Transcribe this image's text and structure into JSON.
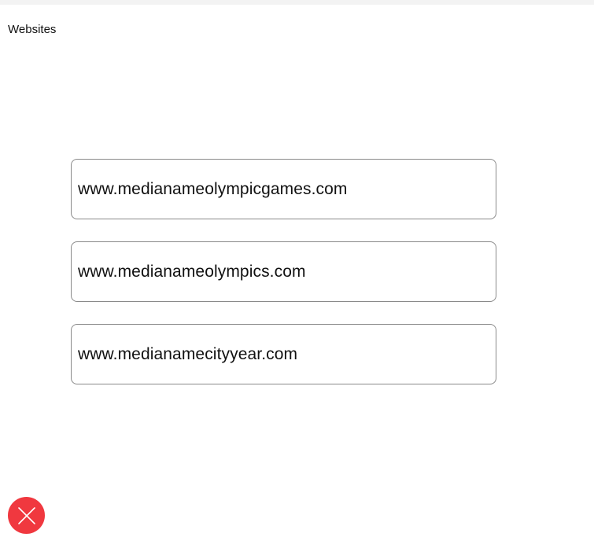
{
  "header": {
    "title": "Websites"
  },
  "sites": [
    {
      "label": "www.medianameolympicgames.com"
    },
    {
      "label": "www.medianameolympics.com"
    },
    {
      "label": "www.medianamecityyear.com"
    }
  ],
  "close_button": {
    "icon": "close-icon",
    "color": "#f0383f"
  }
}
